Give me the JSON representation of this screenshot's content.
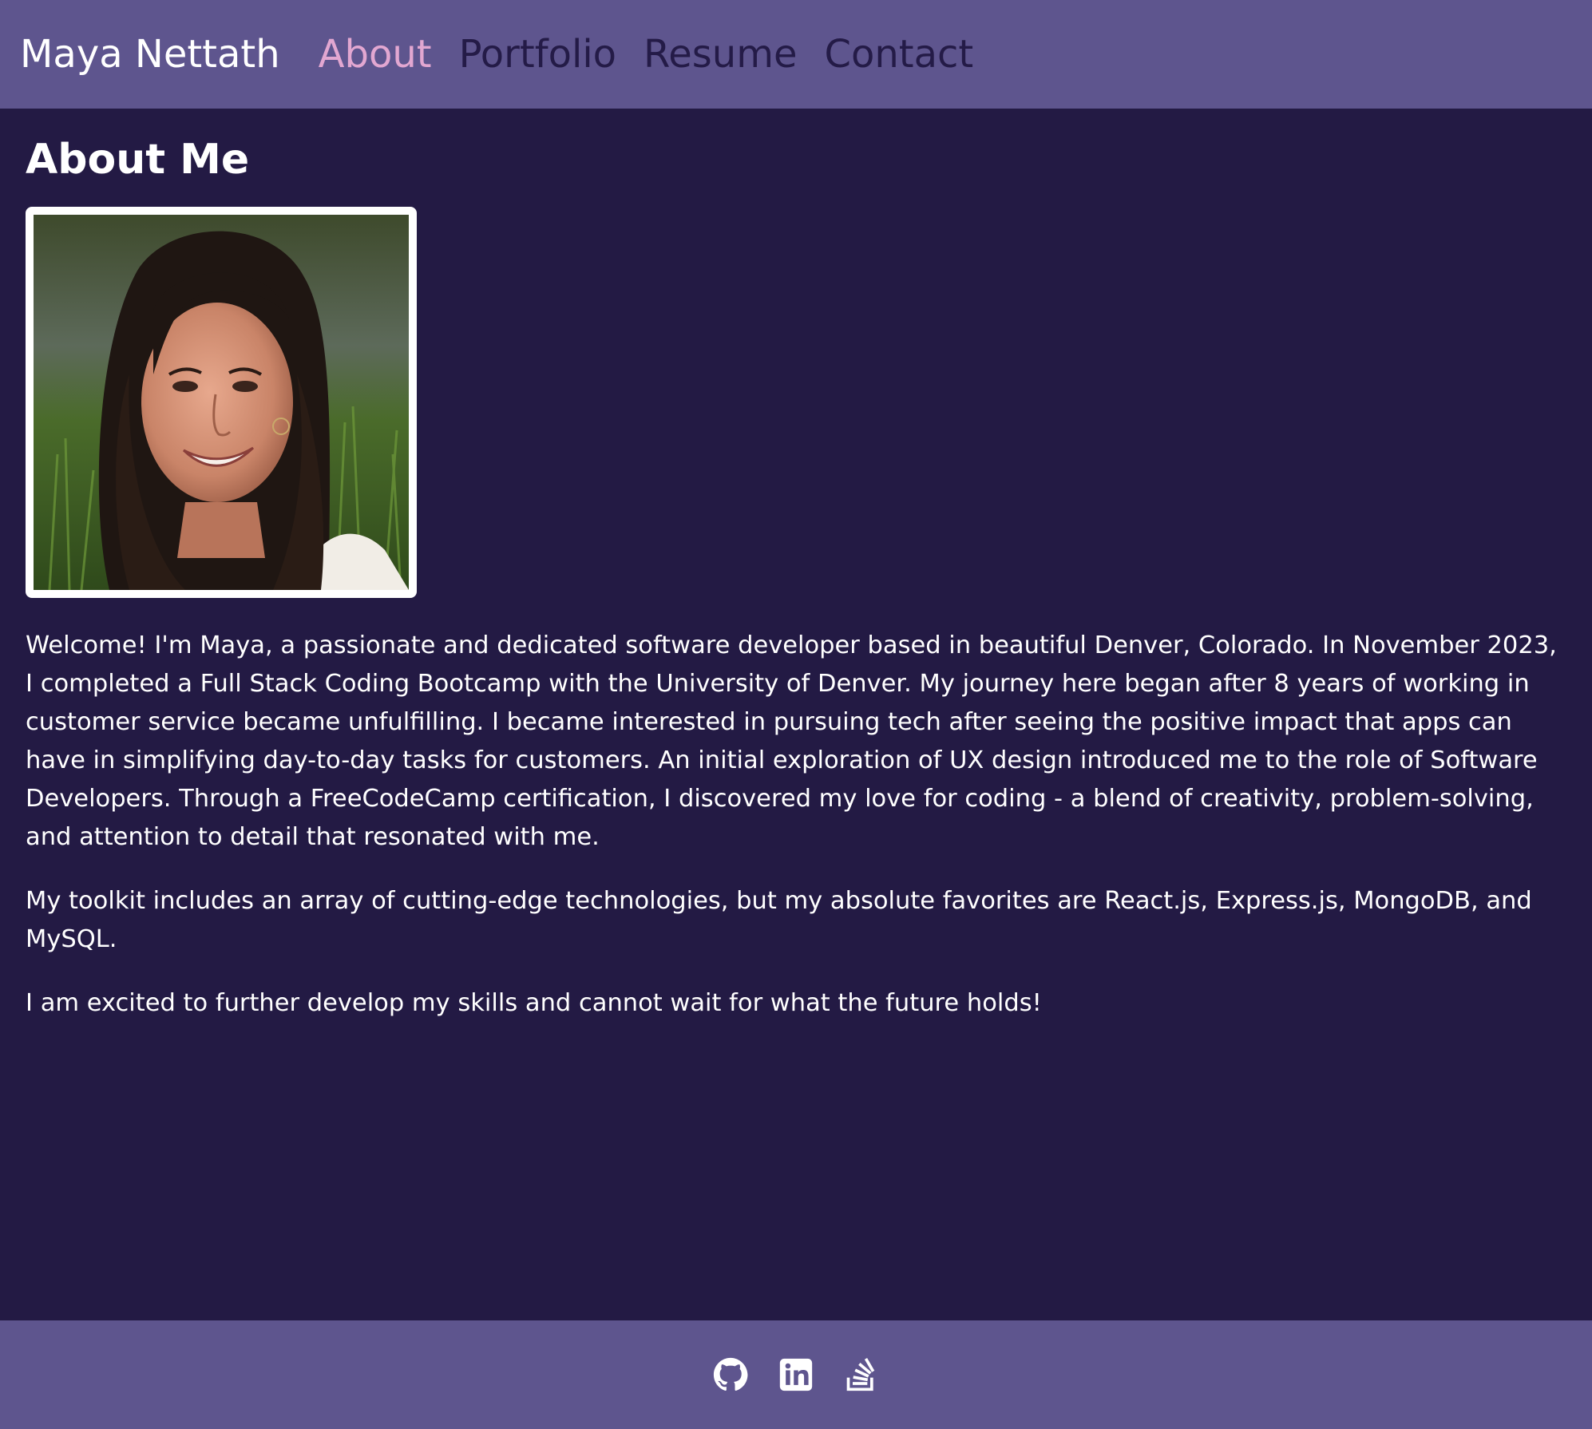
{
  "header": {
    "brand": "Maya Nettath",
    "nav": [
      {
        "label": "About",
        "active": true
      },
      {
        "label": "Portfolio",
        "active": false
      },
      {
        "label": "Resume",
        "active": false
      },
      {
        "label": "Contact",
        "active": false
      }
    ]
  },
  "about": {
    "title": "About Me",
    "paragraphs": [
      "Welcome! I'm Maya, a passionate and dedicated software developer based in beautiful Denver, Colorado. In November 2023, I completed a Full Stack Coding Bootcamp with the University of Denver. My journey here began after 8 years of working in customer service became unfulfilling. I became interested in pursuing tech after seeing the positive impact that apps can have in simplifying day-to-day tasks for customers. An initial exploration of UX design introduced me to the role of Software Developers. Through a FreeCodeCamp certification, I discovered my love for coding - a blend of creativity, problem-solving, and attention to detail that resonated with me.",
      "My toolkit includes an array of cutting-edge technologies, but my absolute favorites are React.js, Express.js, MongoDB, and MySQL.",
      "I am excited to further develop my skills and cannot wait for what the future holds!"
    ]
  },
  "footer": {
    "icons": [
      "github-icon",
      "linkedin-icon",
      "stackoverflow-icon"
    ]
  },
  "colors": {
    "header_bg": "#5e558e",
    "page_bg": "#231a44",
    "nav_active": "#e2a7d1",
    "nav_inactive": "#241b47",
    "text": "#ffffff"
  }
}
